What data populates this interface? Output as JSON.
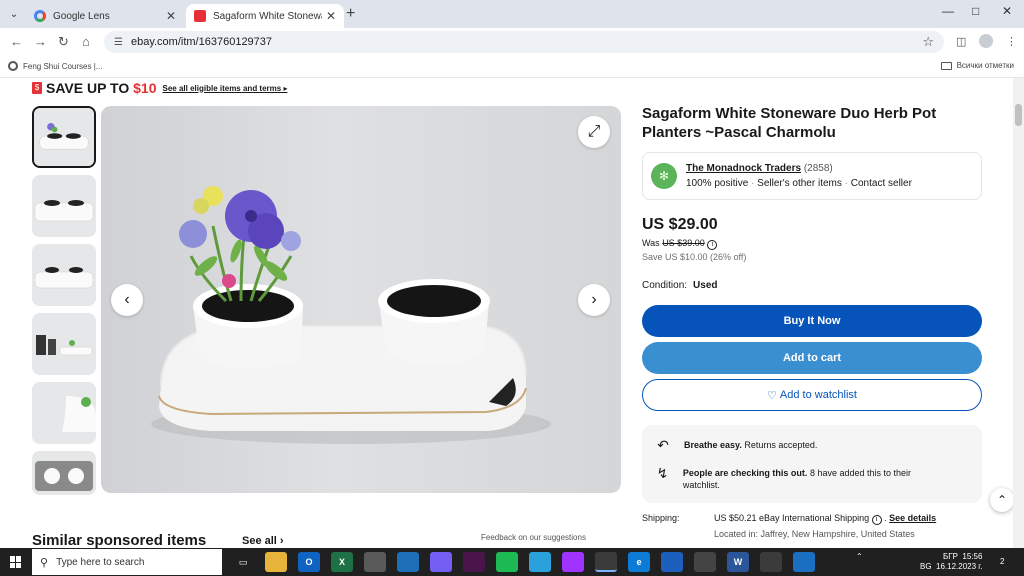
{
  "browser": {
    "tabs": [
      {
        "title": "Google Lens",
        "active": false
      },
      {
        "title": "Sagaform White Stoneware Duo",
        "active": true
      }
    ],
    "url": "ebay.com/itm/163760129737",
    "bookmarks": {
      "left": "Feng Shui Courses |...",
      "right": "Всички отметки"
    }
  },
  "promo": {
    "prefix": "SAVE UP TO ",
    "amount": "$10",
    "terms": "See all eligible items and terms"
  },
  "product": {
    "title": "Sagaform White Stoneware Duo Herb Pot Planters ~Pascal Charmolu",
    "seller": {
      "name": "The Monadnock Traders",
      "count": "(2858)",
      "positive": "100% positive",
      "other_items": "Seller's other items",
      "contact": "Contact seller"
    },
    "price": "US $29.00",
    "was_label": "Was",
    "was_price": "US $39.00",
    "save": "Save US $10.00 (26% off)",
    "condition_label": "Condition:",
    "condition_value": "Used",
    "buy_label": "Buy It Now",
    "cart_label": "Add to cart",
    "watch_label": "Add to watchlist",
    "info": [
      {
        "bold": "Breathe easy.",
        "text": " Returns accepted."
      },
      {
        "bold": "People are checking this out.",
        "text": " 8 have added this to their watchlist."
      }
    ],
    "shipping_label": "Shipping:",
    "shipping_value": "US $50.21 eBay International Shipping",
    "see_details": "See details",
    "location": "Located in: Jaffrey, New Hampshire, United States"
  },
  "similar": {
    "title": "Similar sponsored items",
    "see_all": "See all",
    "feedback": "Feedback on our suggestions"
  },
  "taskbar": {
    "search_placeholder": "Type here to search",
    "lang": "БГР",
    "lang2": "BG",
    "time": "15:56",
    "date": "16.12.2023 г.",
    "notifications": "2"
  },
  "colors": {
    "ebay_blue": "#0654ba",
    "cart_blue": "#3a8fd0",
    "ebay_red": "#e53238"
  },
  "icons": [
    "chevron-down-icon",
    "google-icon",
    "ebay-icon",
    "close-icon",
    "plus-icon",
    "back-icon",
    "forward-icon",
    "reload-icon",
    "home-icon",
    "tune-icon",
    "star-icon",
    "sidepanel-icon",
    "profile-icon",
    "more-icon",
    "expand-icon",
    "chevron-left-icon",
    "chevron-right-icon",
    "heart-icon",
    "info-icon",
    "return-icon",
    "lightning-icon",
    "arrow-up-icon",
    "windows-icon",
    "search-icon"
  ]
}
